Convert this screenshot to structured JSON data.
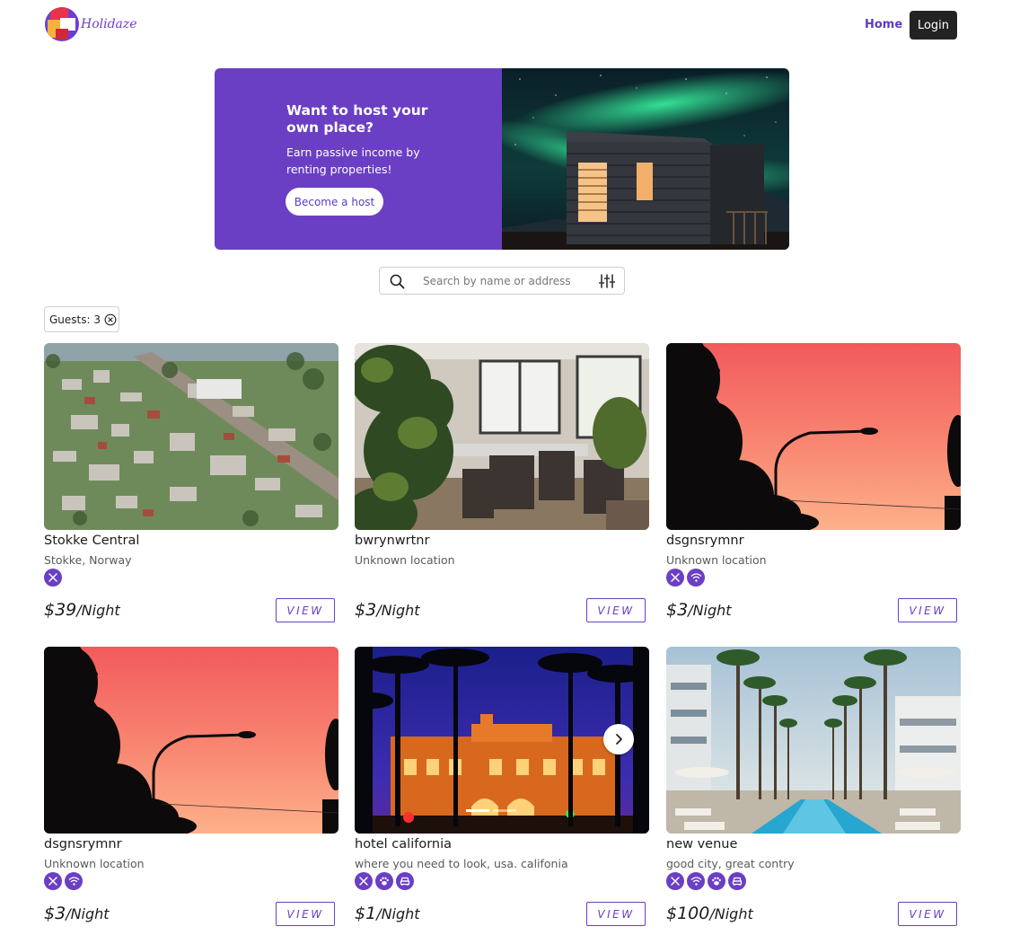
{
  "brand": {
    "name": "Holidaze"
  },
  "nav": {
    "home": "Home",
    "login": "Login"
  },
  "hero": {
    "title": "Want to host your own place?",
    "subtitle": "Earn passive income by renting properties!",
    "button": "Become a host"
  },
  "search": {
    "placeholder": "Search by name or address",
    "value": ""
  },
  "filters": {
    "guests_chip": "Guests: 3"
  },
  "listings": [
    {
      "name": "Stokke Central",
      "location": "Stokke, Norway",
      "amenities": [
        "food-icon"
      ],
      "price": "$39",
      "unit": "/Night",
      "view": "VIEW"
    },
    {
      "name": "bwrynwrtnr",
      "location": "Unknown location",
      "amenities": [],
      "price": "$3",
      "unit": "/Night",
      "view": "VIEW"
    },
    {
      "name": "dsgnsrymnr",
      "location": "Unknown location",
      "amenities": [
        "food-icon",
        "wifi-icon"
      ],
      "price": "$3",
      "unit": "/Night",
      "view": "VIEW"
    },
    {
      "name": "dsgnsrymnr",
      "location": "Unknown location",
      "amenities": [
        "food-icon",
        "wifi-icon"
      ],
      "price": "$3",
      "unit": "/Night",
      "view": "VIEW"
    },
    {
      "name": "hotel california",
      "location": "where you need to look, usa. califonia",
      "amenities": [
        "food-icon",
        "pets-icon",
        "parking-icon"
      ],
      "price": "$1",
      "unit": "/Night",
      "view": "VIEW"
    },
    {
      "name": "new venue",
      "location": "good city, great contry",
      "amenities": [
        "food-icon",
        "wifi-icon",
        "pets-icon",
        "parking-icon"
      ],
      "price": "$100",
      "unit": "/Night",
      "view": "VIEW"
    }
  ],
  "colors": {
    "accent": "#6a3fc4",
    "login_bg": "#232323"
  }
}
